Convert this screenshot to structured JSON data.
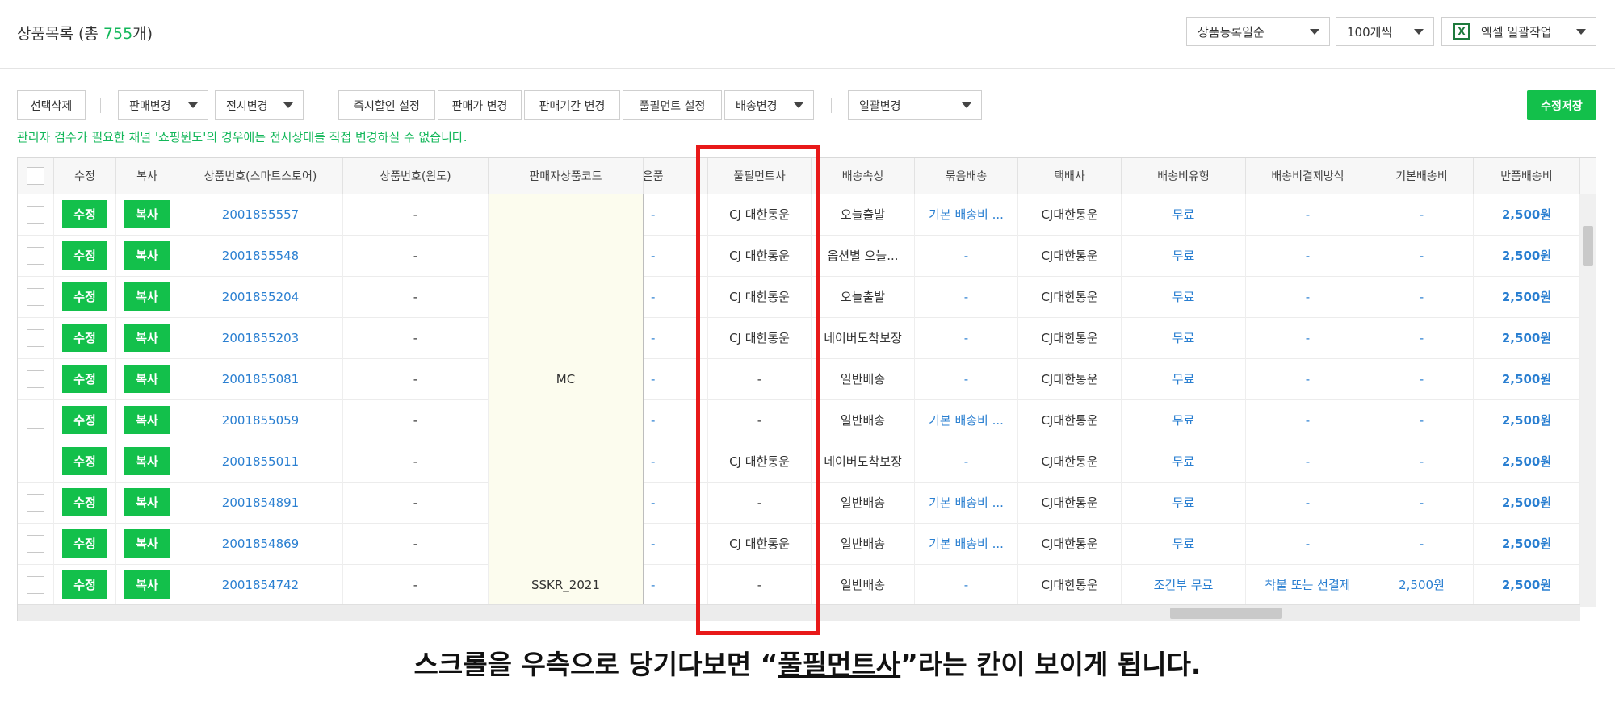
{
  "header": {
    "title_prefix": "상품목록 (총 ",
    "title_count": "755",
    "title_suffix": "개)",
    "sort_select": "상품등록일순",
    "page_size_select": "100개씩",
    "excel_label": "엑셀 일괄작업"
  },
  "toolbar": {
    "delete_selected": "선택삭제",
    "change_sale": "판매변경",
    "change_display": "전시변경",
    "instant_discount": "즉시할인 설정",
    "change_price": "판매가 변경",
    "change_period": "판매기간 변경",
    "fulfillment_setting": "풀필먼트 설정",
    "change_shipping": "배송변경",
    "bulk_change": "일괄변경",
    "save": "수정저장"
  },
  "notice": "관리자 검수가 필요한 채널 '쇼핑윈도'의 경우에는 전시상태를 직접 변경하실 수 없습니다.",
  "table": {
    "columns": {
      "edit": "수정",
      "copy": "복사",
      "product_no_smartstore": "상품번호(스마트스토어)",
      "product_no_window": "상품번호(윈도)",
      "seller_code": "판매자상품코드",
      "gift_partial": "사은품",
      "fulfillment": "풀필먼트사",
      "shipping_attr": "배송속성",
      "bundle_shipping": "묶음배송",
      "courier": "택배사",
      "shipping_fee_type": "배송비유형",
      "shipping_payment": "배송비결제방식",
      "base_fee": "기본배송비",
      "return_fee": "반품배송비"
    },
    "edit_btn": "수정",
    "copy_btn": "복사",
    "rows": [
      {
        "product_no": "2001855557",
        "window_no": "-",
        "seller_code": "",
        "gift": "-",
        "fulfillment": "CJ 대한통운",
        "attr": "오늘출발",
        "bundle": "기본 배송비 ...",
        "courier": "CJ대한통운",
        "fee_type": "무료",
        "payment": "-",
        "base_fee": "-",
        "return_fee": "2,500원"
      },
      {
        "product_no": "2001855548",
        "window_no": "-",
        "seller_code": "",
        "gift": "-",
        "fulfillment": "CJ 대한통운",
        "attr": "옵션별 오늘...",
        "bundle": "-",
        "courier": "CJ대한통운",
        "fee_type": "무료",
        "payment": "-",
        "base_fee": "-",
        "return_fee": "2,500원"
      },
      {
        "product_no": "2001855204",
        "window_no": "-",
        "seller_code": "",
        "gift": "-",
        "fulfillment": "CJ 대한통운",
        "attr": "오늘출발",
        "bundle": "-",
        "courier": "CJ대한통운",
        "fee_type": "무료",
        "payment": "-",
        "base_fee": "-",
        "return_fee": "2,500원"
      },
      {
        "product_no": "2001855203",
        "window_no": "-",
        "seller_code": "",
        "gift": "-",
        "fulfillment": "CJ 대한통운",
        "attr": "네이버도착보장",
        "bundle": "-",
        "courier": "CJ대한통운",
        "fee_type": "무료",
        "payment": "-",
        "base_fee": "-",
        "return_fee": "2,500원"
      },
      {
        "product_no": "2001855081",
        "window_no": "-",
        "seller_code": "MC",
        "gift": "-",
        "fulfillment": "-",
        "attr": "일반배송",
        "bundle": "-",
        "courier": "CJ대한통운",
        "fee_type": "무료",
        "payment": "-",
        "base_fee": "-",
        "return_fee": "2,500원"
      },
      {
        "product_no": "2001855059",
        "window_no": "-",
        "seller_code": "",
        "gift": "-",
        "fulfillment": "-",
        "attr": "일반배송",
        "bundle": "기본 배송비 ...",
        "courier": "CJ대한통운",
        "fee_type": "무료",
        "payment": "-",
        "base_fee": "-",
        "return_fee": "2,500원"
      },
      {
        "product_no": "2001855011",
        "window_no": "-",
        "seller_code": "",
        "gift": "-",
        "fulfillment": "CJ 대한통운",
        "attr": "네이버도착보장",
        "bundle": "-",
        "courier": "CJ대한통운",
        "fee_type": "무료",
        "payment": "-",
        "base_fee": "-",
        "return_fee": "2,500원"
      },
      {
        "product_no": "2001854891",
        "window_no": "-",
        "seller_code": "",
        "gift": "-",
        "fulfillment": "-",
        "attr": "일반배송",
        "bundle": "기본 배송비 ...",
        "courier": "CJ대한통운",
        "fee_type": "무료",
        "payment": "-",
        "base_fee": "-",
        "return_fee": "2,500원"
      },
      {
        "product_no": "2001854869",
        "window_no": "-",
        "seller_code": "",
        "gift": "-",
        "fulfillment": "CJ 대한통운",
        "attr": "일반배송",
        "bundle": "기본 배송비 ...",
        "courier": "CJ대한통운",
        "fee_type": "무료",
        "payment": "-",
        "base_fee": "-",
        "return_fee": "2,500원"
      },
      {
        "product_no": "2001854742",
        "window_no": "-",
        "seller_code": "SSKR_2021",
        "gift": "-",
        "fulfillment": "-",
        "attr": "일반배송",
        "bundle": "-",
        "courier": "CJ대한통운",
        "fee_type": "조건부 무료",
        "payment": "착불 또는 선결제",
        "base_fee": "2,500원",
        "return_fee": "2,500원"
      }
    ]
  },
  "caption": {
    "prefix": "스크롤을 우측으로 당기다보면 “",
    "keyword": "풀필먼트사",
    "suffix": "”라는 칸이 보이게 됩니다."
  },
  "colors": {
    "accent_green": "#13c04b",
    "link_blue": "#2a7fd1",
    "highlight_red": "#e81919"
  }
}
